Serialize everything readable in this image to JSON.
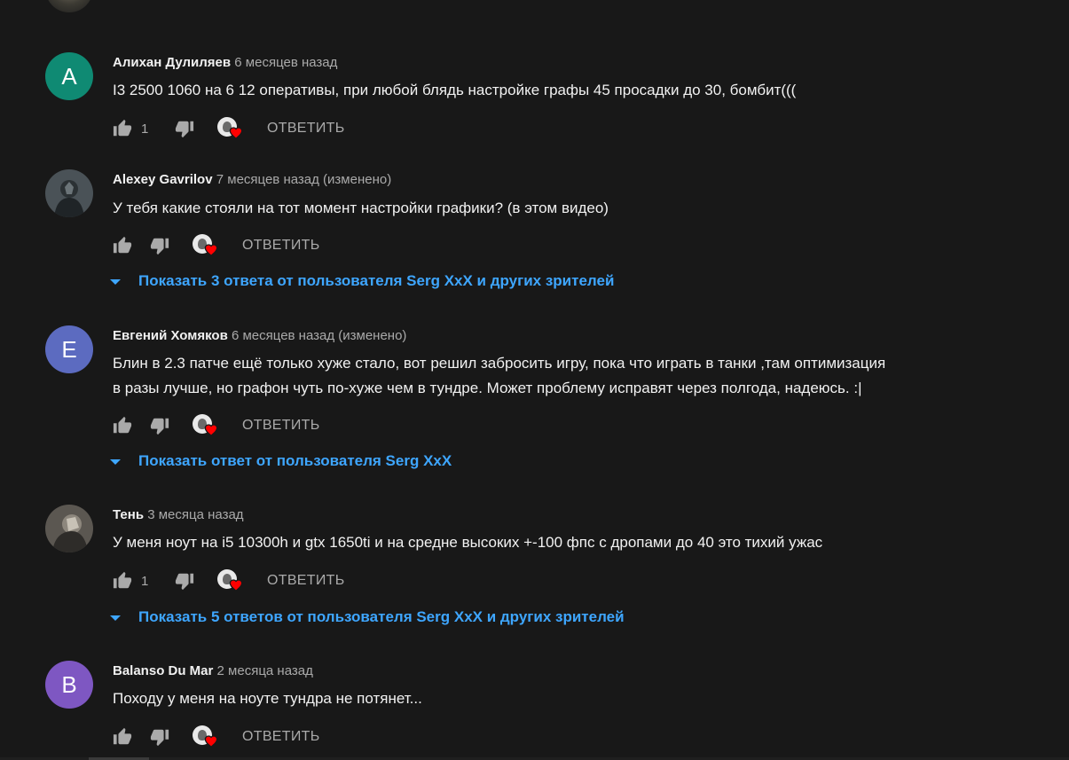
{
  "colors": {
    "background": "#181818",
    "link": "#3ea6ff",
    "heart": "#ff0000"
  },
  "icons": {
    "like": "thumb-up-icon",
    "dislike": "thumb-down-icon",
    "heart": "creator-heart-icon",
    "expand": "triangle-down-icon"
  },
  "comments": [
    {
      "author": "Алихан Дулиляев",
      "time": "6 месяцев назад",
      "avatar_letter": "А",
      "avatar_color": "#0f8a73",
      "text": "I3 2500 1060 на 6 12 оперативы, при любой блядь настройке графы 45 просадки до 30, бомбит(((",
      "likes": "1",
      "reply_label": "ОТВЕТИТЬ"
    },
    {
      "author": "Alexey Gavrilov",
      "time": "7 месяцев назад (изменено)",
      "text": "У тебя какие стояли на тот момент настройки графики? (в этом видео)",
      "likes": "",
      "reply_label": "ОТВЕТИТЬ",
      "replies_link": "Показать 3 ответа от пользователя Serg XxX и других зрителей"
    },
    {
      "author": "Евгений Хомяков",
      "time": "6 месяцев назад (изменено)",
      "avatar_letter": "E",
      "avatar_color": "#5c6bc0",
      "text_line1": "Блин в 2.3 патче ещё только хуже стало, вот решил забросить игру, пока что играть в танки ,там оптимизация",
      "text_line2": "в разы лучше, но графон чуть по-хуже чем в тундре.  Может проблему исправят через полгода, надеюсь. :|",
      "likes": "",
      "reply_label": "ОТВЕТИТЬ",
      "replies_link": "Показать ответ от пользователя Serg XxX"
    },
    {
      "author": "Тень",
      "time": "3 месяца назад",
      "text": "У меня ноут на i5 10300h и gtx 1650ti и на средне высоких +-100 фпс с дропами до 40 это тихий ужас",
      "likes": "1",
      "reply_label": "ОТВЕТИТЬ",
      "replies_link": "Показать 5 ответов от пользователя Serg XxX и других зрителей"
    },
    {
      "author": "Balanso Du Mar",
      "time": "2 месяца назад",
      "avatar_letter": "B",
      "avatar_color": "#7e57c2",
      "text": "Походу у меня на ноуте тундра не потянет...",
      "likes": "",
      "reply_label": "ОТВЕТИТЬ"
    }
  ]
}
